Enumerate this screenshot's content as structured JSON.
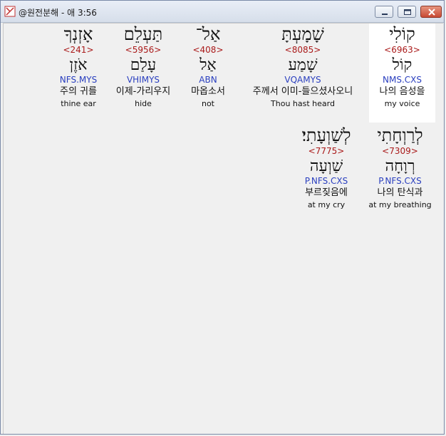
{
  "window": {
    "title": "@원전분해 - 애 3:56"
  },
  "row1": [
    {
      "heb": "קוֹלִי",
      "strong": "<6963>",
      "lemma": "קוֹל",
      "morph": "NMS.CXS",
      "kor": "나의 음성을",
      "eng": "my voice"
    },
    {
      "heb": "שָׁמָעְתָּ",
      "strong": "<8085>",
      "lemma": "שָׁמַע",
      "morph": "VQAMYS",
      "kor": "주께서 이미-들으셨사오니",
      "eng": "Thou hast heard"
    },
    {
      "heb": "אַל־",
      "strong": "<408>",
      "lemma": "אַל",
      "morph": "ABN",
      "kor": "마옵소서",
      "eng": "not"
    },
    {
      "heb": "תַּעְלֵם",
      "strong": "<5956>",
      "lemma": "עָלַם",
      "morph": "VHIMYS",
      "kor": "이제-가리우지",
      "eng": "hide"
    },
    {
      "heb": "אָזְנְךָ",
      "strong": "<241>",
      "lemma": "אֹזֶן",
      "morph": "NFS.MYS",
      "kor": "주의 귀를",
      "eng": "thine ear"
    }
  ],
  "row2": [
    {
      "heb": "לְרַוְחָתִי",
      "strong": "<7309>",
      "lemma": "רְוָחָה",
      "morph": "P.NFS.CXS",
      "kor": "나의 탄식과",
      "eng": "at my breathing"
    },
    {
      "heb": "לְשַׁוְעָתִי׃",
      "strong": "<7775>",
      "lemma": "שַׁוְעָה",
      "morph": "P.NFS.CXS",
      "kor": "부르짖음에",
      "eng": "at my cry"
    }
  ]
}
